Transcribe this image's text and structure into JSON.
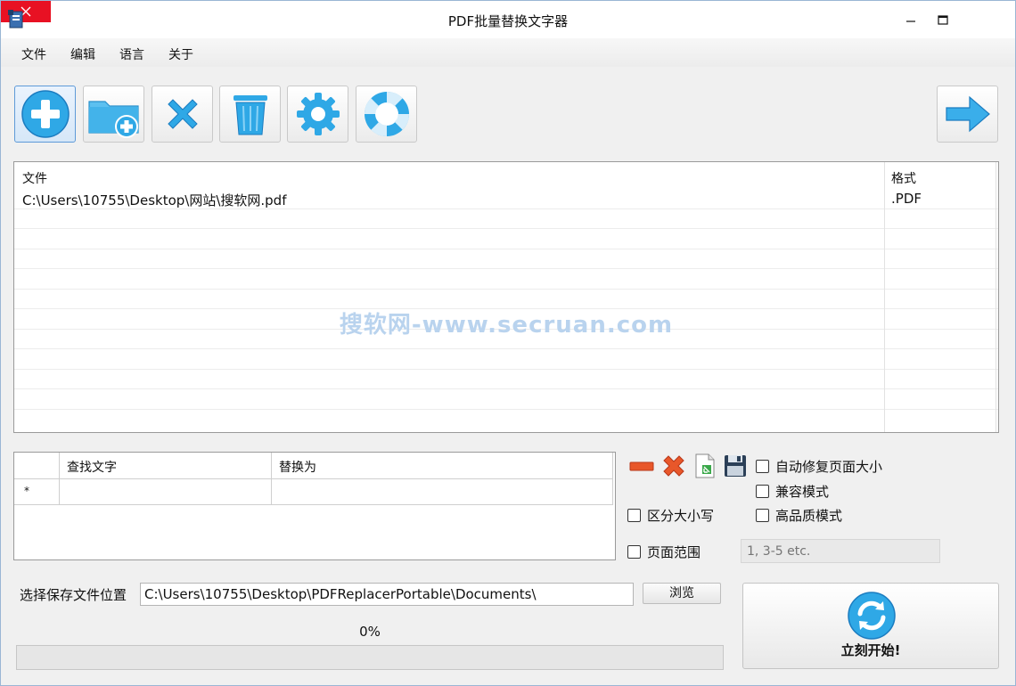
{
  "window": {
    "title": "PDF批量替换文字器"
  },
  "menu": [
    "文件",
    "编辑",
    "语言",
    "关于"
  ],
  "toolbar": {
    "buttons": [
      "add-file",
      "add-folder",
      "remove",
      "clear",
      "settings",
      "help"
    ],
    "go": "next"
  },
  "file_list": {
    "headers": {
      "file": "文件",
      "format": "格式"
    },
    "rows": [
      {
        "file": "C:\\Users\\10755\\Desktop\\网站\\搜软网.pdf",
        "format": ".PDF"
      }
    ],
    "watermark": "搜软网-www.secruan.com"
  },
  "replace_grid": {
    "headers": {
      "find": "查找文字",
      "replace": "替换为"
    },
    "new_row_marker": "*"
  },
  "options": {
    "auto_fix_page_size": "自动修复页面大小",
    "compat_mode": "兼容模式",
    "case_sensitive": "区分大小写",
    "high_quality": "高品质模式",
    "page_range": "页面范围",
    "page_range_placeholder": "1, 3-5 etc."
  },
  "output": {
    "label": "选择保存文件位置",
    "path": "C:\\Users\\10755\\Desktop\\PDFReplacerPortable\\Documents\\",
    "browse": "浏览"
  },
  "progress": {
    "value": 0,
    "text": "0%"
  },
  "start": {
    "label": "立刻开始!"
  },
  "colors": {
    "accent": "#2fa8e6",
    "close": "#e81123"
  }
}
